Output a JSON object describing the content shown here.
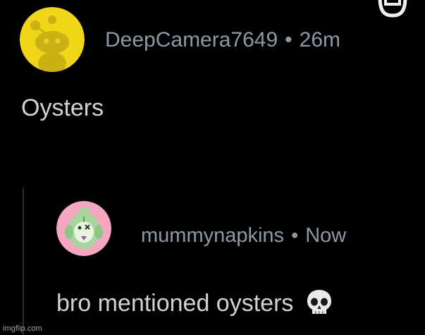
{
  "post": {
    "username": "DeepCamera7649",
    "separator": "•",
    "time": "26m",
    "text": "Oysters",
    "avatar_icon": "snoo-avatar-icon",
    "avatar_color": "#f0d619"
  },
  "reply": {
    "username": "mummynapkins",
    "separator": "•",
    "time": "Now",
    "text": "bro mentioned oysters",
    "emoji_icon": "skull-icon",
    "avatar_icon": "green-creature-avatar-icon",
    "avatar_color": "#f5a7c0"
  },
  "watermark": "imgflip.com"
}
